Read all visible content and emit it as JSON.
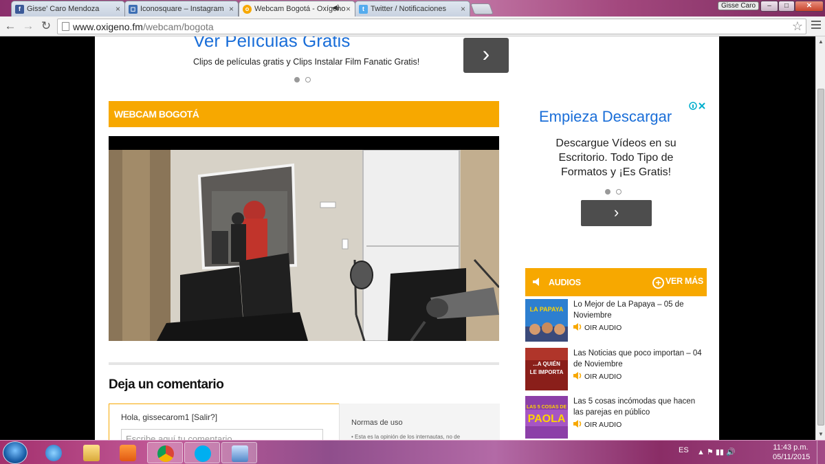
{
  "window": {
    "user_badge": "Gisse Caro",
    "minimize": "–",
    "maximize": "□",
    "close": "✕"
  },
  "tabs": [
    {
      "label": "Gisse' Caro Mendoza",
      "icon": "facebook-icon",
      "color": "#3b5998"
    },
    {
      "label": "Iconosquare – Instagram",
      "icon": "iconosquare-icon",
      "color": "#3d6fb4"
    },
    {
      "label": "Webcam Bogotá - Oxígeno",
      "icon": "oxigeno-icon",
      "color": "#f7a800",
      "active": true
    },
    {
      "label": "Twitter / Notificaciones",
      "icon": "twitter-icon",
      "color": "#55acee"
    }
  ],
  "address_bar": {
    "domain": "www.oxigeno.fm",
    "path": "/webcam/bogota"
  },
  "top_ad": {
    "title": "Ver Películas Gratis",
    "subtitle": "Clips de películas gratis y Clips Instalar Film Fanatic Gratis!",
    "button_glyph": "›"
  },
  "webcam": {
    "section_title": "WEBCAM BOGOTÁ"
  },
  "comments": {
    "heading": "Deja un comentario",
    "greeting": "Hola, gissecarom1 [Salir?]",
    "placeholder": "Escribe aquí tu comentario",
    "rules_title": "Normas de uso",
    "rules_text": "•   Esta es la opinión de los internautas, no de"
  },
  "right_ad": {
    "title": "Empieza Descargar",
    "body": "Descargue Vídeos en su Escritorio. Todo Tipo de Formatos y ¡Es Gratis!",
    "button_glyph": "›"
  },
  "audios": {
    "title": "AUDIOS",
    "more": "VER MÁS",
    "more_glyph": "+",
    "listen_label": "OIR AUDIO",
    "items": [
      {
        "title": "Lo Mejor de La Papaya – 05 de Noviembre",
        "thumb_text": "LA PAPAYA"
      },
      {
        "title": "Las Noticias que poco importan – 04 de Noviembre",
        "thumb_text": "...A QUIÉN LE IMPORTA"
      },
      {
        "title": "Las 5 cosas incómodas que hacen las parejas en público",
        "thumb_text": "LAS 5 COSAS DE PAOLA"
      }
    ]
  },
  "taskbar": {
    "lang": "ES",
    "tray": "▲  ⚑  ▮▮  🔊",
    "time": "11:43 p.m.",
    "date": "05/11/2015"
  },
  "colors": {
    "accent": "#f7a800",
    "ad_link": "#1a6ed8",
    "ad_button": "#4d4d4d"
  }
}
